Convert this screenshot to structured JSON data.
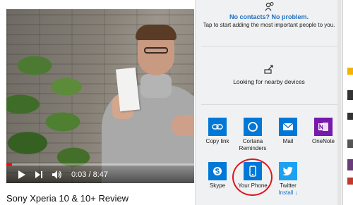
{
  "video": {
    "time": "0:03 / 8:47",
    "progress_fraction": 0.03,
    "title": "Sony Xperia 10 & 10+ Review"
  },
  "share": {
    "contacts_heading": "No contacts? No problem.",
    "contacts_sub": "Tap to start adding the most important people to you.",
    "nearby_label": "Looking for nearby devices",
    "apps": [
      {
        "label": "Copy link",
        "icon": "link-icon",
        "color": "#0078d7"
      },
      {
        "label": "Cortana Reminders",
        "icon": "cortana-icon",
        "color": "#0078d7"
      },
      {
        "label": "Mail",
        "icon": "mail-icon",
        "color": "#0078d7"
      },
      {
        "label": "OneNote",
        "icon": "onenote-icon",
        "color": "#7719aa"
      },
      {
        "label": "Skype",
        "icon": "skype-icon",
        "color": "#0078d7"
      },
      {
        "label": "Your Phone",
        "icon": "phone-icon",
        "color": "#0078d7"
      },
      {
        "label": "Twitter",
        "icon": "twitter-icon",
        "color": "#1da1f2",
        "sub": "Install"
      }
    ]
  },
  "colors": {
    "accent": "#0078d7",
    "link": "#1f6fc0",
    "highlight": "#e0141e",
    "progress": "#ff0000"
  }
}
